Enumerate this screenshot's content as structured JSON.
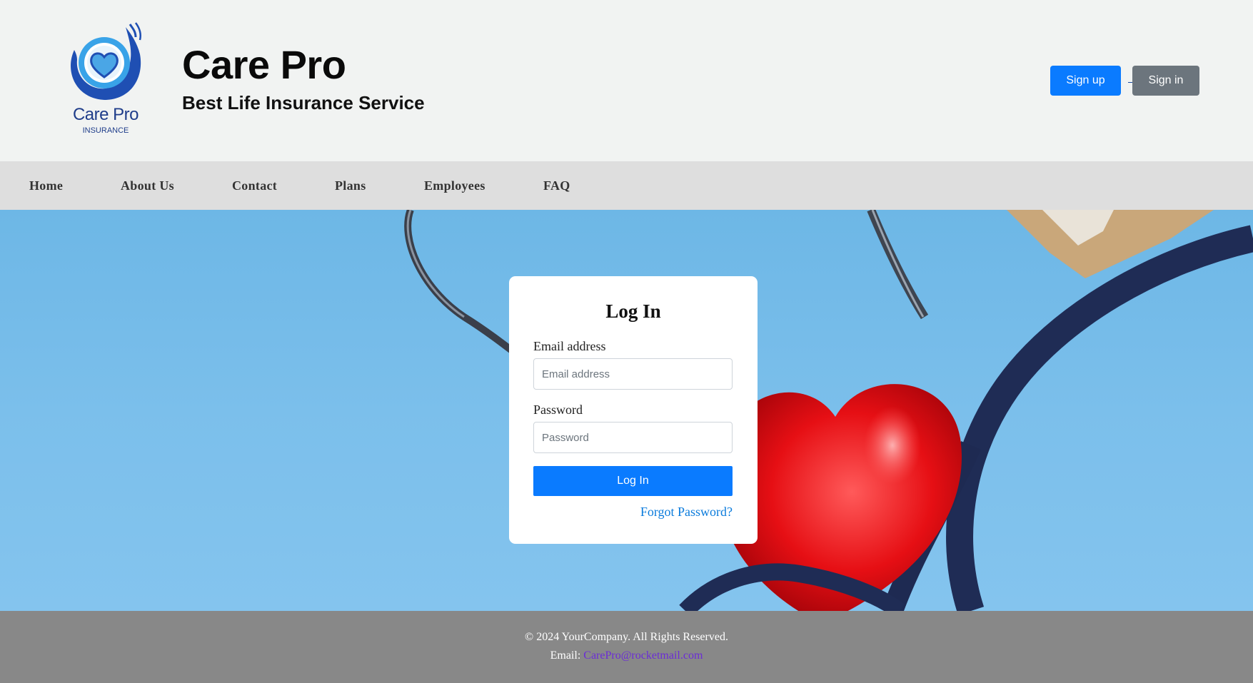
{
  "header": {
    "logo": {
      "name": "Care Pro",
      "subtitle": "INSURANCE",
      "icon": "heart-hands-logo-icon"
    },
    "title": "Care Pro",
    "subtitle": "Best Life Insurance Service",
    "signup_label": "Sign up",
    "signin_label": "Sign in"
  },
  "nav": {
    "items": [
      {
        "label": "Home"
      },
      {
        "label": "About Us"
      },
      {
        "label": "Contact"
      },
      {
        "label": "Plans"
      },
      {
        "label": "Employees"
      },
      {
        "label": "FAQ"
      }
    ]
  },
  "login": {
    "title": "Log In",
    "email_label": "Email address",
    "email_placeholder": "Email address",
    "password_label": "Password",
    "password_placeholder": "Password",
    "submit_label": "Log In",
    "forgot_label": "Forgot Password?"
  },
  "footer": {
    "copyright": "© 2024 YourCompany. All Rights Reserved.",
    "email_prefix": "Email: ",
    "email": "CarePro@rocketmail.com"
  },
  "colors": {
    "primary": "#0a7bff",
    "secondary": "#6c757d",
    "nav_bg": "#dedede",
    "footer_bg": "#888888",
    "hero_bg": "#7bbfeb",
    "logo_blue": "#1f3d8a"
  }
}
